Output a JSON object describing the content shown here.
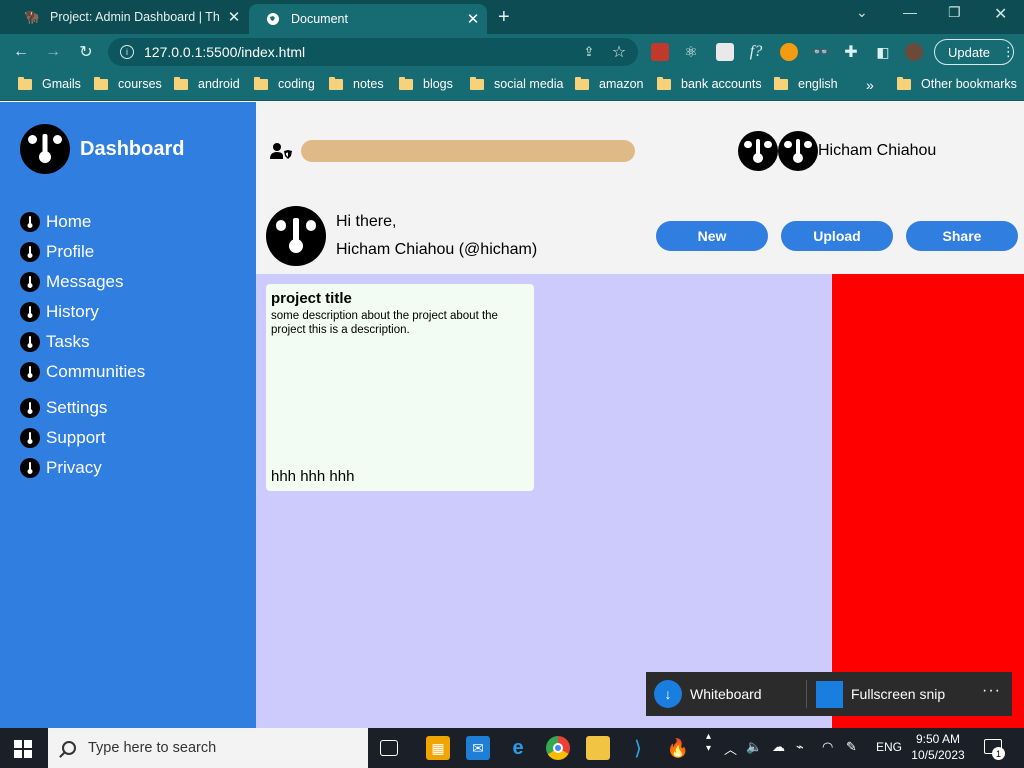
{
  "browser": {
    "tabs": [
      {
        "title": "Project: Admin Dashboard | The O",
        "active": false
      },
      {
        "title": "Document",
        "active": true
      }
    ],
    "url": "127.0.0.1:5500/index.html",
    "update_label": "Update",
    "bookmarks": [
      "Gmails",
      "courses",
      "android",
      "coding",
      "notes",
      "blogs",
      "social media",
      "amazon",
      "bank accounts",
      "english"
    ],
    "overflow_label": "»",
    "other_bookmarks_label": "Other bookmarks"
  },
  "sidebar": {
    "brand": "Dashboard",
    "nav": [
      {
        "label": "Home"
      },
      {
        "label": "Profile"
      },
      {
        "label": "Messages"
      },
      {
        "label": "History"
      },
      {
        "label": "Tasks"
      },
      {
        "label": "Communities"
      },
      {
        "label": "Settings"
      },
      {
        "label": "Support"
      },
      {
        "label": "Privacy"
      }
    ],
    "background": "#2f7ee0"
  },
  "header": {
    "search_placeholder": "",
    "user_name": "Hicham Chiahou",
    "greeting": "Hi there,",
    "handle": "Hicham Chiahou (@hicham)",
    "buttons": {
      "new": "New",
      "upload": "Upload",
      "share": "Share"
    }
  },
  "content": {
    "card": {
      "title": "project title",
      "description": "some description about the project about the project this is a description.",
      "footer": "hhh hhh hhh"
    }
  },
  "snip_toast": {
    "whiteboard_label": "Whiteboard",
    "fullscreen_label": "Fullscreen snip",
    "more_label": "···"
  },
  "taskbar": {
    "search_placeholder": "Type here to search",
    "language": "ENG",
    "time": "9:50 AM",
    "date": "10/5/2023",
    "notification_count": "1"
  },
  "colors": {
    "accent": "#2f7ee0",
    "content_bg": "#cdcbfc",
    "right_panel": "#ff0000",
    "search_bar": "#dfba87",
    "browser_chrome": "#176b73"
  }
}
